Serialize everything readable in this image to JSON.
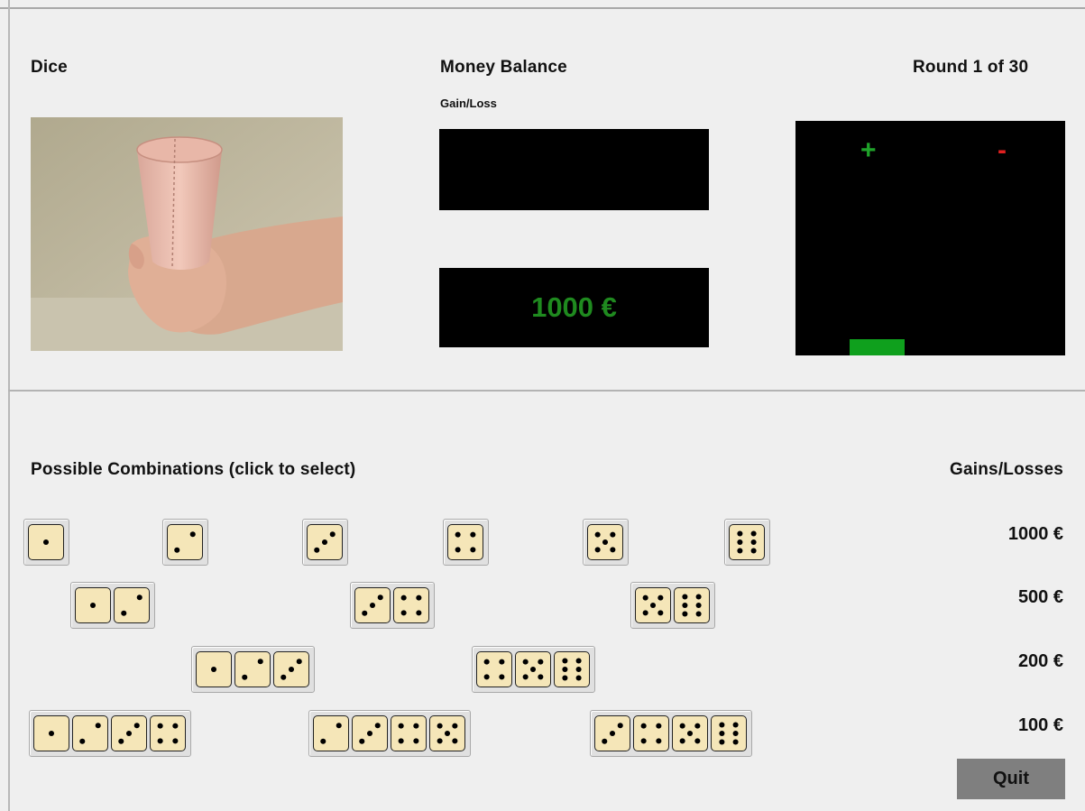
{
  "header": {
    "dice_label": "Dice",
    "money_label": "Money Balance",
    "gain_loss_label": "Gain/Loss",
    "round_label": "Round 1 of 30"
  },
  "balance": {
    "gain_loss_value": "",
    "total": "1000 €",
    "total_color": "#1f8a1f"
  },
  "graph": {
    "plus_sign": "+",
    "minus_sign": "-",
    "plus_color": "#1fa32a",
    "minus_color": "#e02020",
    "bar_color": "#0fa01d"
  },
  "combinations": {
    "title": "Possible Combinations (click to select)",
    "gains_title": "Gains/Losses",
    "rows": [
      {
        "gain": "1000 €",
        "options": [
          [
            1
          ],
          [
            2
          ],
          [
            3
          ],
          [
            4
          ],
          [
            5
          ],
          [
            6
          ]
        ]
      },
      {
        "gain": "500 €",
        "options": [
          [
            1,
            2
          ],
          [
            3,
            4
          ],
          [
            5,
            6
          ]
        ]
      },
      {
        "gain": "200 €",
        "options": [
          [
            1,
            2,
            3
          ],
          [
            4,
            5,
            6
          ]
        ]
      },
      {
        "gain": "100 €",
        "options": [
          [
            1,
            2,
            3,
            4
          ],
          [
            2,
            3,
            4,
            5
          ],
          [
            3,
            4,
            5,
            6
          ]
        ]
      }
    ]
  },
  "quit_label": "Quit"
}
